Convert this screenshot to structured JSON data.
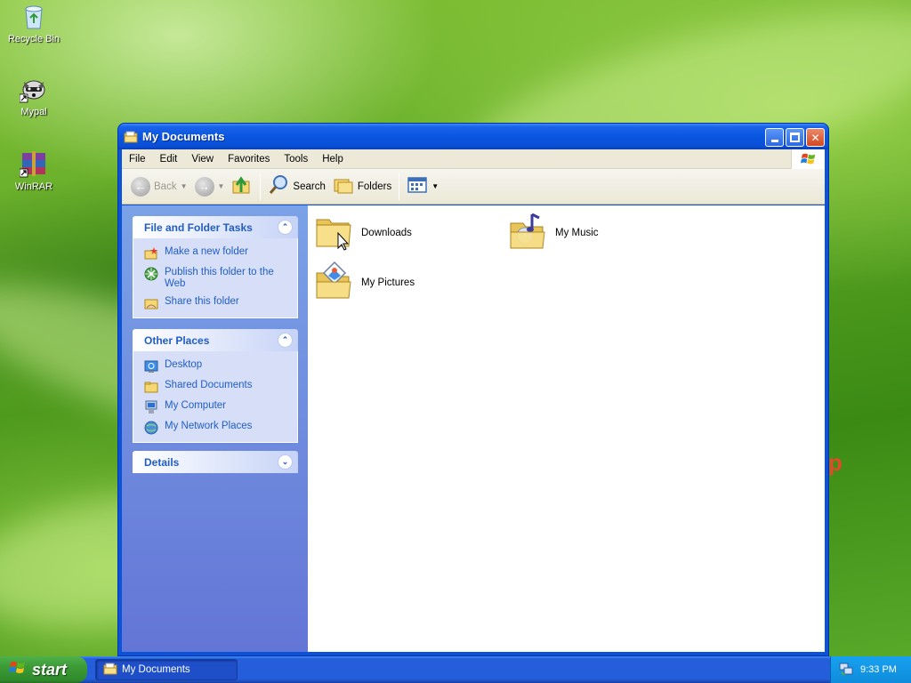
{
  "desktop": {
    "icons": [
      {
        "label": "Recycle Bin",
        "icon": "recycle-bin-icon"
      },
      {
        "label": "Mypal",
        "icon": "mypal-icon"
      },
      {
        "label": "WinRAR",
        "icon": "winrar-icon"
      }
    ],
    "stray_text": "p"
  },
  "window": {
    "title": "My Documents",
    "menu": [
      "File",
      "Edit",
      "View",
      "Favorites",
      "Tools",
      "Help"
    ],
    "toolbar": {
      "back_label": "Back",
      "search_label": "Search",
      "folders_label": "Folders"
    },
    "taskpane": {
      "file_tasks": {
        "title": "File and Folder Tasks",
        "items": [
          "Make a new folder",
          "Publish this folder to the Web",
          "Share this folder"
        ]
      },
      "other_places": {
        "title": "Other Places",
        "items": [
          "Desktop",
          "Shared Documents",
          "My Computer",
          "My Network Places"
        ]
      },
      "details": {
        "title": "Details"
      }
    },
    "items": [
      {
        "label": "Downloads",
        "icon": "folder-icon"
      },
      {
        "label": "My Music",
        "icon": "music-folder-icon"
      },
      {
        "label": "My Pictures",
        "icon": "pictures-folder-icon"
      }
    ]
  },
  "taskbar": {
    "start_label": "start",
    "task_button": "My Documents",
    "clock": "9:33 PM"
  }
}
